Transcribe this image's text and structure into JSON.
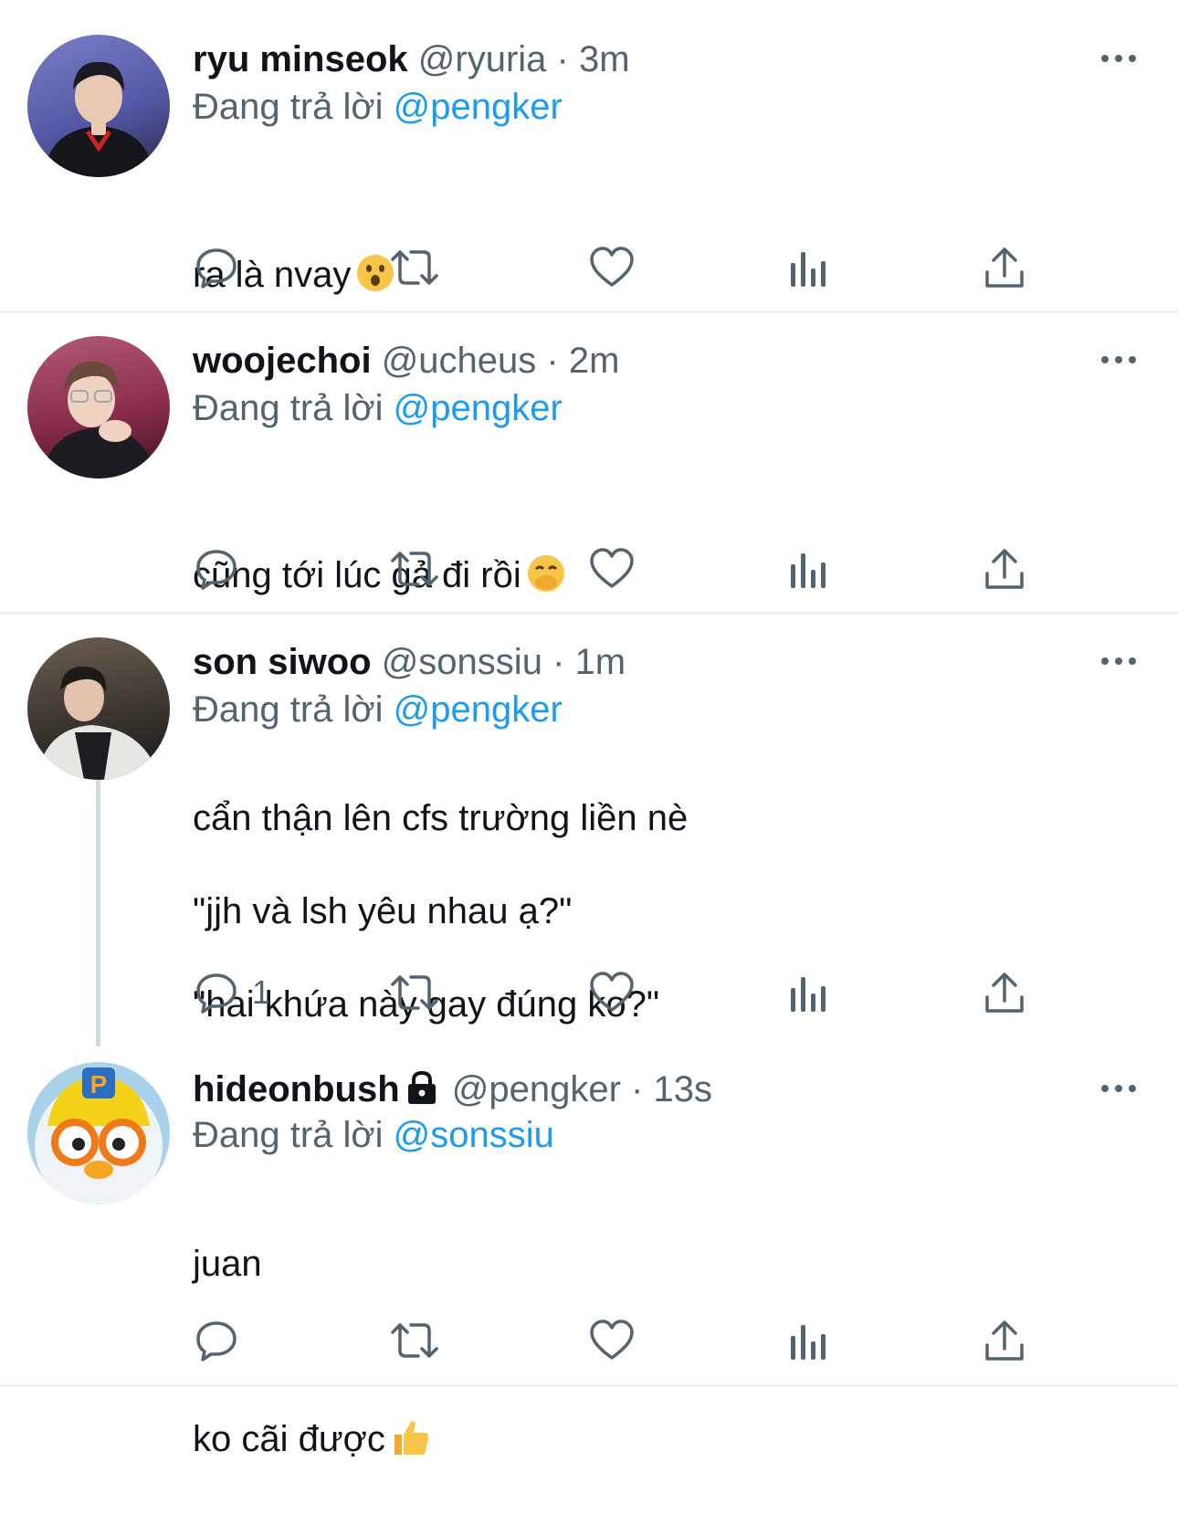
{
  "reply_prefix": "Đang trả lời",
  "colors": {
    "link": "#1d9bf0",
    "secondary": "#536471",
    "text": "#0f1419",
    "divider": "#eff3f4"
  },
  "tweets": [
    {
      "display_name": "ryu minseok",
      "handle": "@ryuria",
      "time": "3m",
      "reply_to": "@pengker",
      "text_lines": [
        "ra là nvay"
      ],
      "emoji": "hushed-face",
      "reply_count": "",
      "locked": false
    },
    {
      "display_name": "woojechoi",
      "handle": "@ucheus",
      "time": "2m",
      "reply_to": "@pengker",
      "text_lines": [
        "cũng tới lúc gả đi rồi"
      ],
      "emoji": "face-with-hand-over-mouth",
      "reply_count": "",
      "locked": false
    },
    {
      "display_name": "son siwoo",
      "handle": "@sonssiu",
      "time": "1m",
      "reply_to": "@pengker",
      "text_lines": [
        "cẩn thận lên cfs trường liền nè",
        "\"jjh và lsh yêu nhau ạ?\"",
        "\"hai khứa này gay đúng ko?\""
      ],
      "emoji": "",
      "reply_count": "1",
      "locked": false
    },
    {
      "display_name": "hideonbush",
      "handle": "@pengker",
      "time": "13s",
      "reply_to": "@sonssiu",
      "text_lines": [
        "juan",
        "ko cãi được"
      ],
      "emoji": "thumbs-up",
      "reply_count": "",
      "locked": true
    }
  ]
}
